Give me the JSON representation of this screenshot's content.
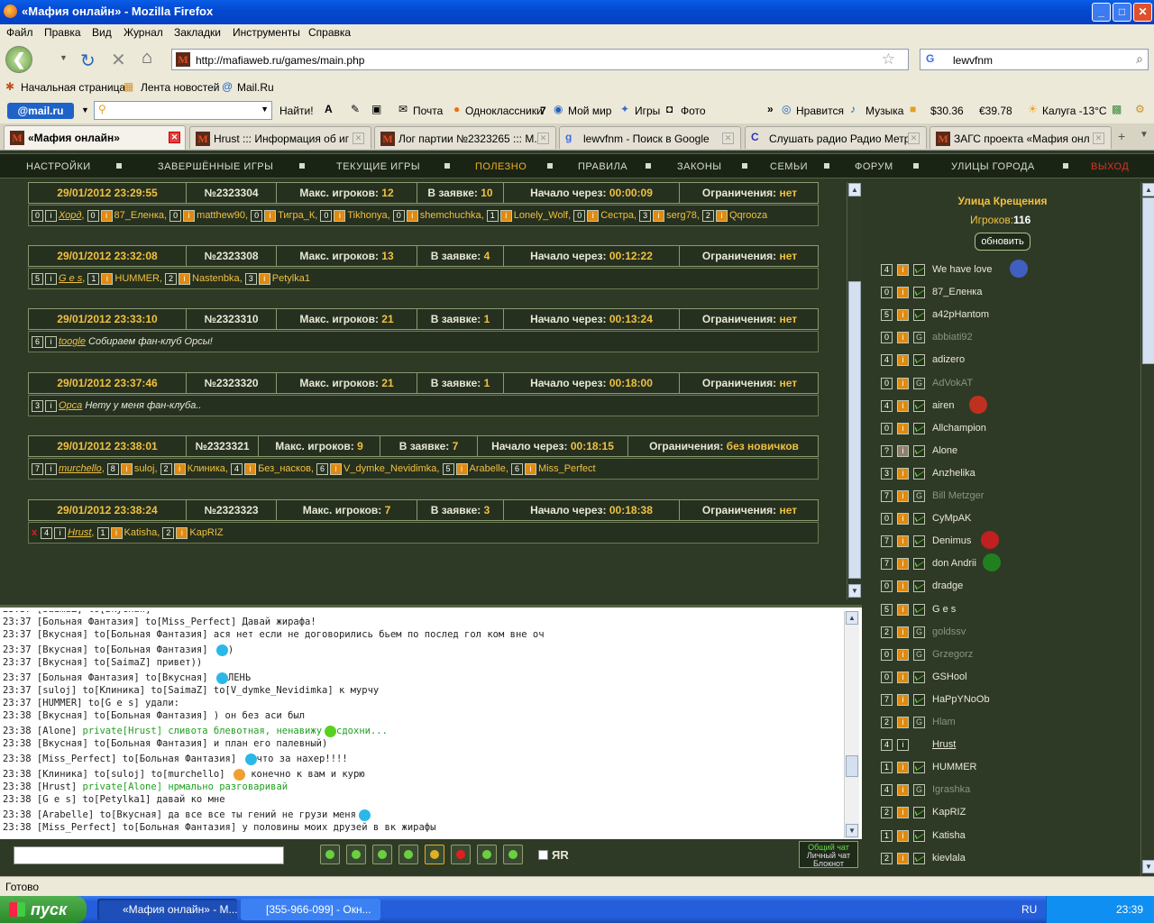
{
  "window": {
    "title": "«Мафия онлайн» - Mozilla Firefox",
    "minimize": "_",
    "maximize": "□",
    "close": "✕"
  },
  "menu": [
    "Файл",
    "Правка",
    "Вид",
    "Журнал",
    "Закладки",
    "Инструменты",
    "Справка"
  ],
  "nav": {
    "back": "❮",
    "url": "http://mafiaweb.ru/games/main.php",
    "search_value": "lewvfnm"
  },
  "bookmarks": [
    "Начальная страница",
    "Лента новостей",
    "Mail.Ru"
  ],
  "mailbar": {
    "logo": "@mail.ru",
    "find": "Найти!",
    "pochta": "Почта",
    "odnoklassniki": "Одноклассники",
    "odno_count": "7",
    "moimir": "Мой мир",
    "igry": "Игры",
    "foto": "Фото",
    "more": "»",
    "nravitsya": "Нравится",
    "muzyka": "Музыка",
    "usd": "$30.36",
    "eur": "€39.78",
    "weather": "Калуга -13°C"
  },
  "tabs": [
    {
      "label": "«Мафия онлайн»"
    },
    {
      "label": "Hrust ::: Информация об игр..."
    },
    {
      "label": "Лог партии №2323265 ::: М..."
    },
    {
      "label": "lewvfnm - Поиск в Google"
    },
    {
      "label": "Слушать радио Радио Метр..."
    },
    {
      "label": "ЗАГС проекта «Мафия онла..."
    }
  ],
  "sitenav": {
    "items": [
      "НАСТРОЙКИ",
      "ЗАВЕРШЁННЫЕ ИГРЫ",
      "ТЕКУЩИЕ ИГРЫ",
      "ПОЛЕЗНО",
      "ПРАВИЛА",
      "ЗАКОНЫ",
      "СЕМЬИ",
      "ФОРУМ",
      "УЛИЦЫ ГОРОДА"
    ],
    "exit": "ВЫХОД"
  },
  "refresh": "обновить",
  "labels": {
    "max": "Макс. игроков:",
    "zayavka": "В заявке:",
    "start": "Начало через:",
    "limit": "Ограничения:"
  },
  "games": [
    {
      "date": "29/01/2012 23:29:55",
      "num": "№2323304",
      "max": "12",
      "inreq": "10",
      "start": "00:00:09",
      "limit": "нет",
      "players": [
        [
          "0",
          "Хорд",
          true
        ],
        [
          "0",
          "87_Еленка",
          false
        ],
        [
          "0",
          "matthew90",
          false
        ],
        [
          "0",
          "Тигра_К",
          false
        ],
        [
          "0",
          "Tikhonya",
          false
        ],
        [
          "0",
          "shemchuchka",
          false
        ],
        [
          "1",
          "Lonely_Wolf",
          false
        ],
        [
          "0",
          "Сестра",
          false
        ],
        [
          "3",
          "serg78",
          false
        ],
        [
          "2",
          "Qqrooza",
          false
        ]
      ]
    },
    {
      "date": "29/01/2012 23:32:08",
      "num": "№2323308",
      "max": "13",
      "inreq": "4",
      "start": "00:12:22",
      "limit": "нет",
      "players": [
        [
          "5",
          "G e s",
          true
        ],
        [
          "1",
          "HUMMER",
          false
        ],
        [
          "2",
          "Nastenbka",
          false
        ],
        [
          "3",
          "Petylka1",
          false
        ]
      ]
    },
    {
      "date": "29/01/2012 23:33:10",
      "num": "№2323310",
      "max": "21",
      "inreq": "1",
      "start": "00:13:24",
      "limit": "нет",
      "players": [
        [
          "6",
          "toogle",
          true
        ]
      ],
      "note": "Собираем фан-клуб Орсы!"
    },
    {
      "date": "29/01/2012 23:37:46",
      "num": "№2323320",
      "max": "21",
      "inreq": "1",
      "start": "00:18:00",
      "limit": "нет",
      "players": [
        [
          "3",
          "Орса",
          true
        ]
      ],
      "note": "Нету у меня фан-клуба.."
    },
    {
      "date": "29/01/2012 23:38:01",
      "num": "№2323321",
      "max": "9",
      "inreq": "7",
      "start": "00:18:15",
      "limit": "без новичков",
      "players": [
        [
          "7",
          "murchello",
          true
        ],
        [
          "8",
          "suloj",
          false
        ],
        [
          "2",
          "Клиника",
          false
        ],
        [
          "4",
          "Без_насков",
          false
        ],
        [
          "6",
          "V_dymke_Nevidimka",
          false
        ],
        [
          "5",
          "Arabelle",
          false
        ],
        [
          "6",
          "Miss_Perfect",
          false
        ]
      ]
    },
    {
      "date": "29/01/2012 23:38:24",
      "num": "№2323323",
      "max": "7",
      "inreq": "3",
      "start": "00:18:38",
      "limit": "нет",
      "x": "x",
      "players": [
        [
          "4",
          "Hrust",
          true
        ],
        [
          "1",
          "Katisha",
          false
        ],
        [
          "2",
          "KapRIZ",
          false
        ]
      ]
    }
  ],
  "chat": [
    {
      "t": "23:37 [Больная Фантазия] to[Miss_Perfect] Давай жирафа!"
    },
    {
      "t": "23:37 [Вкусная] to[Больная Фантазия] ася нет если не договорились бьем по послед гол ком вне оч"
    },
    {
      "t": "23:37 [Вкусная] to[Больная Фантазия] ",
      "emo": "b",
      "tail": ")"
    },
    {
      "t": "23:37 [Вкусная] to[SaimaZ] привет))"
    },
    {
      "t": "23:37 [Больная Фантазия] to[Вкусная] ",
      "emo": "b",
      "tail": "ЛЕНЬ"
    },
    {
      "t": "23:37 [suloj] to[Клиника] to[SaimaZ] to[V_dymke_Nevidimka] к мурчу"
    },
    {
      "t": "23:37 [HUMMER] to[G e s] удали:"
    },
    {
      "t": "23:38 [Вкусная] to[Больная Фантазия] ) он без аси был"
    },
    {
      "t": "23:38 [Alone] ",
      "pm": "private[Hrust] сливота блевотная, ненавижу",
      "emo": "g",
      "tail2": "сдохни..."
    },
    {
      "t": "23:38 [Вкусная] to[Больная Фантазия] и план его палевный)"
    },
    {
      "t": "23:38 [Miss_Perfect] to[Больная Фантазия] ",
      "emo": "b",
      "tail": "что за нахер!!!!"
    },
    {
      "t": "23:38 [Клиника] to[suloj] to[murchello] ",
      "emo": "y",
      "tail": " конечно к вам и курю"
    },
    {
      "t": "23:38 [Hrust] ",
      "pm": "private[Alone] нрмально разговаривай"
    },
    {
      "t": "23:38 [G e s] to[Petylka1] давай ко мне"
    },
    {
      "t": "23:38 [Arabelle] to[Вкусная] да все все ты гений не грузи меня",
      "emo": "b"
    },
    {
      "t": "23:38 [Miss_Perfect] to[Больная Фантазия] у половины моих друзей в вк жирафы"
    }
  ],
  "chatmode": {
    "general": "Общий чат",
    "personal": "Личный чат",
    "notepad": "Блокнот",
    "yr": "ЯR"
  },
  "street": {
    "title": "Улица Крещения",
    "players_label": "Игроков:",
    "players_count": "116"
  },
  "street_players": [
    [
      "4",
      "We have love",
      false
    ],
    [
      "0",
      "87_Еленка",
      false
    ],
    [
      "5",
      "a42pHantom",
      false
    ],
    [
      "0",
      "abbiati92",
      true
    ],
    [
      "4",
      "adizero",
      false
    ],
    [
      "0",
      "AdVokAT",
      true
    ],
    [
      "4",
      "airen",
      false
    ],
    [
      "0",
      "Allchampion",
      false
    ],
    [
      "?",
      "Alone",
      false
    ],
    [
      "3",
      "Anzhelika",
      false
    ],
    [
      "7",
      "Bill Metzger",
      true
    ],
    [
      "0",
      "CyMpAK",
      false
    ],
    [
      "7",
      "Denimus",
      false
    ],
    [
      "7",
      "don Andrii",
      false
    ],
    [
      "0",
      "dradge",
      false
    ],
    [
      "5",
      "G e s",
      false
    ],
    [
      "2",
      "goldssv",
      true
    ],
    [
      "0",
      "Grzegorz",
      true
    ],
    [
      "0",
      "GSHool",
      false
    ],
    [
      "7",
      "HaPpYNoOb",
      false
    ],
    [
      "2",
      "Hlam",
      true
    ],
    [
      "4",
      "Hrust",
      false
    ],
    [
      "1",
      "HUMMER",
      false
    ],
    [
      "4",
      "Igrashka",
      true
    ],
    [
      "2",
      "KapRIZ",
      false
    ],
    [
      "1",
      "Katisha",
      false
    ],
    [
      "2",
      "kievlala",
      false
    ]
  ],
  "status": "Готово",
  "taskbar": {
    "start": "пуск",
    "task1": "«Мафия онлайн» - М...",
    "task2": "[355-966-099] - Окн...",
    "lang": "RU",
    "clock": "23:39"
  }
}
